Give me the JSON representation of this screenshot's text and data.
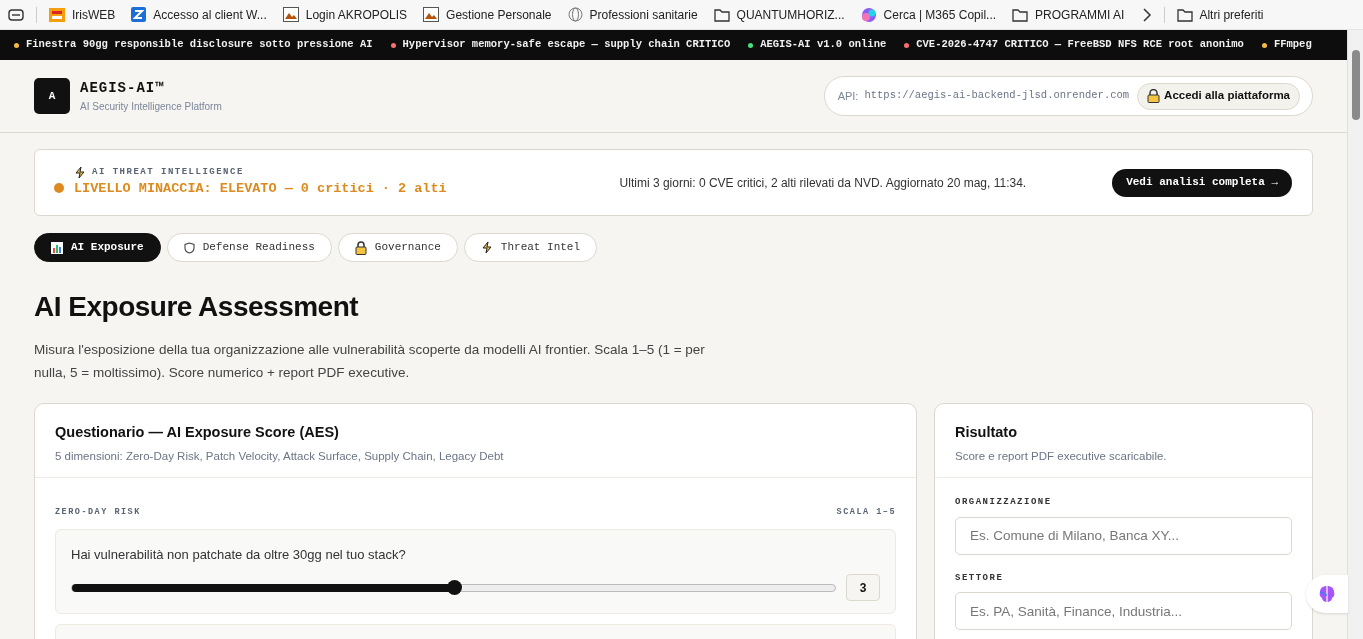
{
  "bookmarks": [
    {
      "label": "IrisWEB",
      "kind": "logo"
    },
    {
      "label": "Accesso al client W...",
      "kind": "z"
    },
    {
      "label": "Login AKROPOLIS",
      "kind": "img"
    },
    {
      "label": "Gestione Personale",
      "kind": "img"
    },
    {
      "label": "Professioni sanitarie",
      "kind": "globe"
    },
    {
      "label": "QUANTUMHORIZ...",
      "kind": "folder"
    },
    {
      "label": "Cerca | M365 Copil...",
      "kind": "copilot"
    },
    {
      "label": "PROGRAMMI AI",
      "kind": "folder"
    }
  ],
  "more_bookmarks": "Altri preferiti",
  "ticker": [
    {
      "text": "Finestra 90gg responsible disclosure sotto pressione AI",
      "color": "#f5b942"
    },
    {
      "text": "Hypervisor memory-safe escape — supply chain CRITICO",
      "color": "#f87171"
    },
    {
      "text": "AEGIS-AI v1.0 online",
      "color": "#4ade80"
    },
    {
      "text": "CVE-2026-4747 CRITICO — FreeBSD NFS RCE root anonimo",
      "color": "#f87171"
    },
    {
      "text": "FFmpeg",
      "color": "#f5b942"
    }
  ],
  "brand": {
    "logo": "A",
    "name": "AEGIS-AI™",
    "tagline": "AI Security Intelligence Platform"
  },
  "api": {
    "label": "API:",
    "url": "https://aegis-ai-backend-jlsd.onrender.com",
    "login": "Accedi alla piattaforma"
  },
  "alert": {
    "kicker": "AI THREAT INTELLIGENCE",
    "level": "LIVELLO MINACCIA: ELEVATO — 0 critici · 2 alti",
    "color": "#dd8a1e",
    "summary": "Ultimi 3 giorni: 0 CVE critici, 2 alti rilevati da NVD. Aggiornato 20 mag, 11:34.",
    "action": "Vedi analisi completa →"
  },
  "tabs": [
    {
      "label": "AI Exposure",
      "kind": "chart",
      "selected": true
    },
    {
      "label": "Defense Readiness",
      "kind": "shield",
      "selected": false
    },
    {
      "label": "Governance",
      "kind": "lock",
      "selected": false
    },
    {
      "label": "Threat Intel",
      "kind": "bolt",
      "selected": false
    }
  ],
  "page": {
    "title": "AI Exposure Assessment",
    "description": "Misura l'esposizione della tua organizzazione alle vulnerabilità scoperte da modelli AI frontier. Scala 1–5 (1 = per nulla, 5 = moltissimo). Score numerico + report PDF executive."
  },
  "questionnaire": {
    "title": "Questionario — AI Exposure Score (AES)",
    "subtitle": "5 dimensioni: Zero-Day Risk, Patch Velocity, Attack Surface, Supply Chain, Legacy Debt",
    "section": "ZERO-DAY RISK",
    "scale": "SCALA 1–5",
    "questions": [
      {
        "text": "Hai vulnerabilità non patchate da oltre 30gg nel tuo stack?",
        "level": 0.5,
        "value": "3"
      }
    ]
  },
  "result": {
    "title": "Risultato",
    "subtitle": "Score e report PDF executive scaricabile.",
    "fields": [
      {
        "label": "ORGANIZZAZIONE",
        "placeholder": "Es. Comune di Milano, Banca XY..."
      },
      {
        "label": "SETTORE",
        "placeholder": "Es. PA, Sanità, Finance, Industria..."
      }
    ]
  }
}
